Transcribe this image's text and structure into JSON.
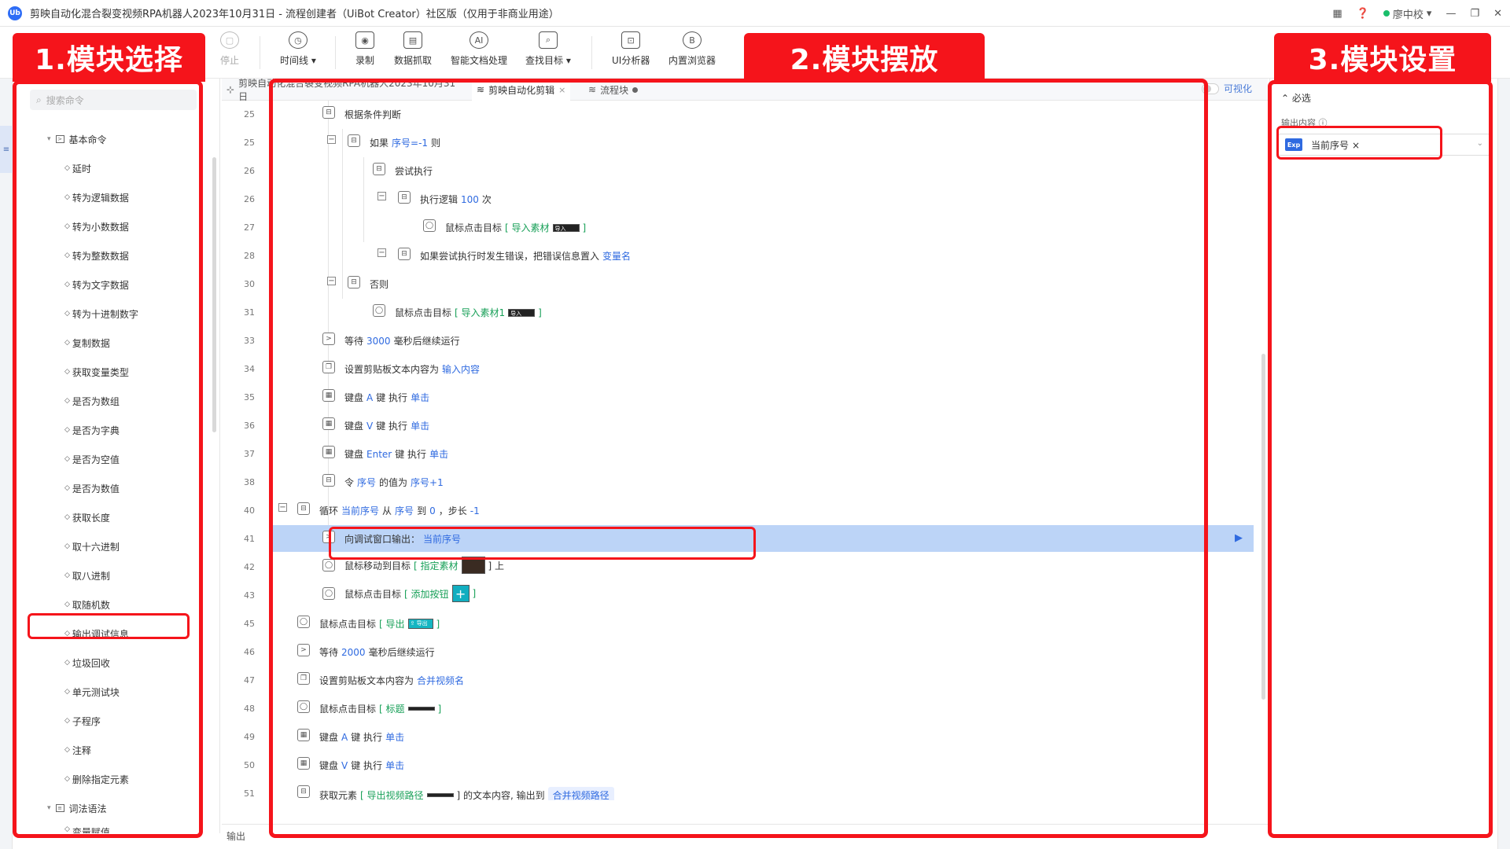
{
  "window": {
    "title": "剪映自动化混合裂变视频RPA机器人2023年10月31日 - 流程创建者（UiBot Creator）社区版（仅用于非商业用途）",
    "logo": "Ub",
    "user": "廖中校"
  },
  "toolbar": {
    "items": [
      {
        "label": "停止",
        "icon": "stop-icon"
      },
      {
        "label": "时间线 ▾",
        "icon": "clock-icon"
      },
      {
        "label": "录制",
        "icon": "record-icon"
      },
      {
        "label": "数据抓取",
        "icon": "data-grab-icon"
      },
      {
        "label": "智能文档处理",
        "icon": "ai-doc-icon"
      },
      {
        "label": "查找目标 ▾",
        "icon": "find-target-icon"
      },
      {
        "label": "UI分析器",
        "icon": "ui-analyzer-icon"
      },
      {
        "label": "内置浏览器",
        "icon": "browser-icon"
      }
    ]
  },
  "sidebar": {
    "search_placeholder": "搜索命令",
    "group1": "基本命令",
    "items": [
      "延时",
      "转为逻辑数据",
      "转为小数数据",
      "转为整数数据",
      "转为文字数据",
      "转为十进制数字",
      "复制数据",
      "获取变量类型",
      "是否为数组",
      "是否为字典",
      "是否为空值",
      "是否为数值",
      "获取长度",
      "取十六进制",
      "取八进制",
      "取随机数",
      "输出调试信息",
      "垃圾回收",
      "单元测试块",
      "子程序",
      "注释",
      "删除指定元素"
    ],
    "group2": "词法语法",
    "cut_item": "变量赋值"
  },
  "tabs": {
    "project": "剪映自动化混合裂变视频RPA机器人2023年10月31日",
    "flow": "剪映自动化剪辑",
    "block": "流程块",
    "visual_toggle": "可视化"
  },
  "code": {
    "lines": [
      "25",
      "25",
      "26",
      "26",
      "27",
      "28",
      "30",
      "31",
      "33",
      "34",
      "35",
      "36",
      "37",
      "38",
      "40",
      "41",
      "42",
      "43",
      "45",
      "46",
      "47",
      "48",
      "49",
      "50",
      "51"
    ],
    "t0": "根据条件判断",
    "t1a": "如果",
    "t1b": "序号=-1",
    "t1c": "则",
    "t2": "尝试执行",
    "t3a": "执行逻辑",
    "t3b": "100",
    "t3c": "次",
    "t4a": "鼠标点击目标",
    "t4b": "[ 导入素材",
    "t4c": "]",
    "t5a": "如果尝试执行时发生错误，把错误信息置入",
    "t5b": "变量名",
    "t6": "否则",
    "t7a": "鼠标点击目标",
    "t7b": "[ 导入素材1",
    "t7c": "]",
    "t8a": "等待",
    "t8b": "3000",
    "t8c": "毫秒后继续运行",
    "t9a": "设置剪贴板文本内容为",
    "t9b": "输入内容",
    "t10a": "键盘",
    "t10b": "A",
    "t10c": "键 执行",
    "t10d": "单击",
    "t11a": "键盘",
    "t11b": "V",
    "t11c": "键 执行",
    "t11d": "单击",
    "t12a": "键盘",
    "t12b": "Enter",
    "t12c": "键 执行",
    "t12d": "单击",
    "t13a": "令",
    "t13b": "序号",
    "t13c": "的值为",
    "t13d": "序号+1",
    "t14a": "循环",
    "t14b": "当前序号",
    "t14c": "从",
    "t14d": "序号",
    "t14e": "到",
    "t14f": "0",
    "t14g": "，步长",
    "t14h": "-1",
    "t15a": "向调试窗口输出：",
    "t15b": "当前序号",
    "t16a": "鼠标移动到目标",
    "t16b": "[ 指定素材",
    "t16c": "] 上",
    "t17a": "鼠标点击目标",
    "t17b": "[ 添加按钮",
    "t17c": "]",
    "t18a": "鼠标点击目标",
    "t18b": "[ 导出",
    "t18c": "]",
    "t19a": "等待",
    "t19b": "2000",
    "t19c": "毫秒后继续运行",
    "t20a": "设置剪贴板文本内容为",
    "t20b": "合并视频名",
    "t21a": "鼠标点击目标",
    "t21b": "[ 标题",
    "t21c": "]",
    "t22a": "键盘",
    "t22b": "A",
    "t22c": "键 执行",
    "t22d": "单击",
    "t23a": "键盘",
    "t23b": "V",
    "t23c": "键 执行",
    "t23d": "单击",
    "t24a": "获取元素",
    "t24b": "[ 导出视频路径",
    "t24c": "] 的文本内容, 输出到",
    "t24d": "合并视频路径",
    "thumb_import": "导入",
    "thumb_export": "⇪ 导出"
  },
  "bottom": {
    "label": "输出"
  },
  "right_panel": {
    "header": "必选",
    "field_label": "输出内容",
    "exp": "Exp",
    "tag": "当前序号"
  },
  "annotations": {
    "label1": "1.模块选择",
    "label2": "2.模块摆放",
    "label3": "3.模块设置"
  },
  "colors": {
    "annotation_red": "#f5141b",
    "accent_blue": "#2f6ae0",
    "target_green": "#18a058",
    "selected_row": "#bcd4f7"
  }
}
